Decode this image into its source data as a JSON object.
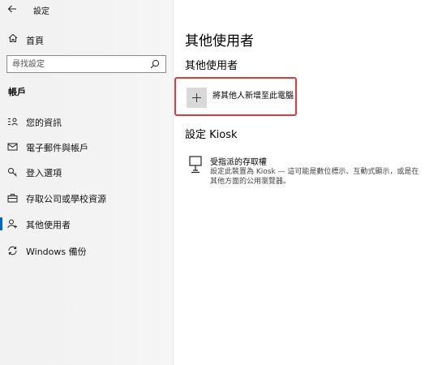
{
  "window": {
    "title": "設定"
  },
  "sidebar": {
    "home_label": "首頁",
    "search": {
      "placeholder": "尋找設定",
      "value": ""
    },
    "section_label": "帳戶",
    "items": [
      {
        "label": "您的資訊",
        "icon": "user-info-icon",
        "selected": false
      },
      {
        "label": "電子郵件與帳戶",
        "icon": "mail-icon",
        "selected": false
      },
      {
        "label": "登入選項",
        "icon": "key-icon",
        "selected": false
      },
      {
        "label": "存取公司或學校資源",
        "icon": "briefcase-icon",
        "selected": false
      },
      {
        "label": "其他使用者",
        "icon": "person-add-icon",
        "selected": true
      },
      {
        "label": "Windows 備份",
        "icon": "sync-icon",
        "selected": false
      }
    ]
  },
  "main": {
    "page_title": "其他使用者",
    "sub_heading": "其他使用者",
    "add_user_label": "將其他人新增至此電腦",
    "kiosk_heading": "設定 Kiosk",
    "kiosk_item": {
      "title": "受指派的存取權",
      "description": "設定此裝置為 Kiosk — 這可能是數位標示、互動式顯示，或是在其他方面的公用瀏覽器。"
    }
  },
  "colors": {
    "accent": "#0067c0",
    "highlight_border": "#e03b3b",
    "sidebar_bg": "#f3f3f3",
    "tile_bg": "#d9d9d9"
  }
}
